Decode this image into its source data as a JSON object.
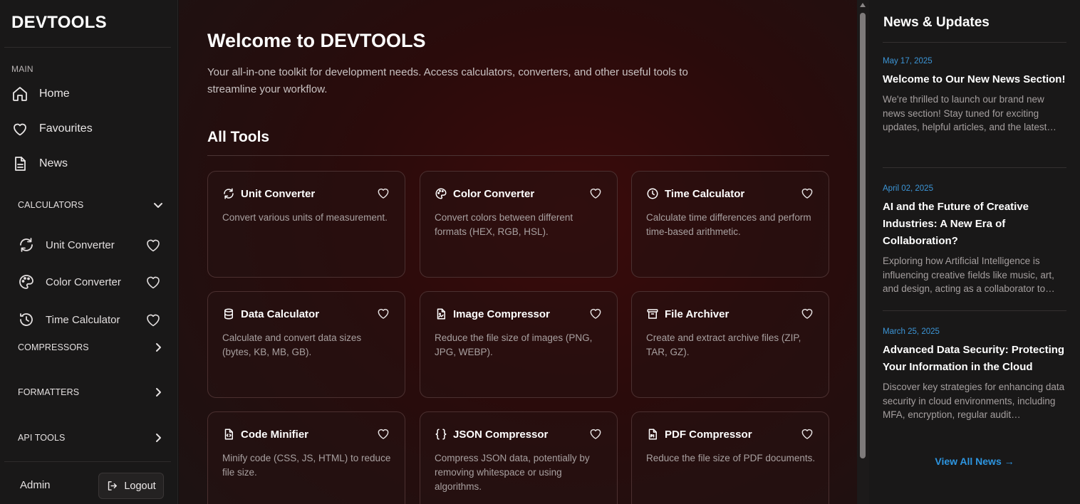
{
  "sidebar": {
    "brand": "DEVTOOLS",
    "main_label": "MAIN",
    "main_items": [
      {
        "label": "Home",
        "icon": "home-icon"
      },
      {
        "label": "Favourites",
        "icon": "heart-icon"
      },
      {
        "label": "News",
        "icon": "document-icon"
      }
    ],
    "categories": [
      {
        "label": "CALCULATORS",
        "expanded": true
      },
      {
        "label": "COMPRESSORS",
        "expanded": false
      },
      {
        "label": "FORMATTERS",
        "expanded": false
      },
      {
        "label": "API TOOLS",
        "expanded": false
      }
    ],
    "calculator_items": [
      {
        "label": "Unit Converter",
        "icon": "refresh-icon"
      },
      {
        "label": "Color Converter",
        "icon": "palette-icon"
      },
      {
        "label": "Time Calculator",
        "icon": "clock-icon"
      }
    ],
    "user": "Admin",
    "logout_label": "Logout"
  },
  "main": {
    "title": "Welcome to DEVTOOLS",
    "subtitle": "Your all-in-one toolkit for development needs. Access calculators, converters, and other useful tools to streamline your workflow.",
    "section_title": "All Tools",
    "tools": [
      {
        "name": "Unit Converter",
        "desc": "Convert various units of measurement.",
        "icon": "refresh-icon"
      },
      {
        "name": "Color Converter",
        "desc": "Convert colors between different formats (HEX, RGB, HSL).",
        "icon": "palette-icon"
      },
      {
        "name": "Time Calculator",
        "desc": "Calculate time differences and perform time-based arithmetic.",
        "icon": "clock-icon"
      },
      {
        "name": "Data Calculator",
        "desc": "Calculate and convert data sizes (bytes, KB, MB, GB).",
        "icon": "database-icon"
      },
      {
        "name": "Image Compressor",
        "desc": "Reduce the file size of images (PNG, JPG, WEBP).",
        "icon": "image-file-icon"
      },
      {
        "name": "File Archiver",
        "desc": "Create and extract archive files (ZIP, TAR, GZ).",
        "icon": "archive-icon"
      },
      {
        "name": "Code Minifier",
        "desc": "Minify code (CSS, JS, HTML) to reduce file size.",
        "icon": "code-file-icon"
      },
      {
        "name": "JSON Compressor",
        "desc": "Compress JSON data, potentially by removing whitespace or using algorithms.",
        "icon": "braces-icon"
      },
      {
        "name": "PDF Compressor",
        "desc": "Reduce the file size of PDF documents.",
        "icon": "pdf-file-icon"
      }
    ]
  },
  "news": {
    "header": "News & Updates",
    "items": [
      {
        "date": "May 17, 2025",
        "title": "Welcome to Our New News Section!",
        "excerpt": "We're thrilled to launch our brand new news section! Stay tuned for exciting updates, helpful articles, and the latest…"
      },
      {
        "date": "April 02, 2025",
        "title": "AI and the Future of Creative Industries: A New Era of Collaboration?",
        "excerpt": "Exploring how Artificial Intelligence is influencing creative fields like music, art, and design, acting as a collaborator to…"
      },
      {
        "date": "March 25, 2025",
        "title": "Advanced Data Security: Protecting Your Information in the Cloud",
        "excerpt": "Discover key strategies for enhancing data security in cloud environments, including MFA, encryption, regular audit…"
      }
    ],
    "view_all": "View All News →"
  },
  "colors": {
    "background": "#141212",
    "panel": "#191818",
    "accent_red": "#3b0b0b",
    "link_blue": "#2d95e0",
    "date_blue": "#3c95d6"
  }
}
